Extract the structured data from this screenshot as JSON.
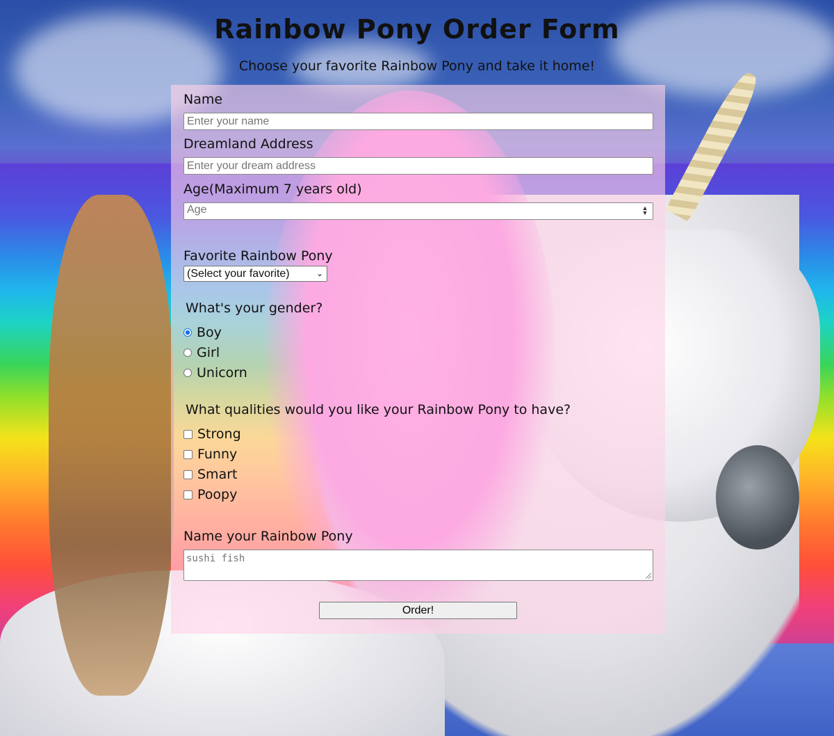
{
  "header": {
    "title": "Rainbow Pony Order Form",
    "subtitle": "Choose your favorite Rainbow Pony and take it home!"
  },
  "form": {
    "name": {
      "label": "Name",
      "placeholder": "Enter your name",
      "value": ""
    },
    "address": {
      "label": "Dreamland Address",
      "placeholder": "Enter your dream address",
      "value": ""
    },
    "age": {
      "label": "Age(Maximum 7 years old)",
      "placeholder": "Age",
      "value": ""
    },
    "favorite": {
      "label": "Favorite Rainbow Pony",
      "selected": "(Select your favorite)"
    },
    "gender": {
      "question": "What's your gender?",
      "options": [
        {
          "label": "Boy",
          "checked": true
        },
        {
          "label": "Girl",
          "checked": false
        },
        {
          "label": "Unicorn",
          "checked": false
        }
      ]
    },
    "qualities": {
      "question": "What qualities would you like your Rainbow Pony to have?",
      "options": [
        {
          "label": "Strong",
          "checked": false
        },
        {
          "label": "Funny",
          "checked": false
        },
        {
          "label": "Smart",
          "checked": false
        },
        {
          "label": "Poopy",
          "checked": false
        }
      ]
    },
    "pony_name": {
      "label": "Name your Rainbow Pony",
      "placeholder": "sushi fish",
      "value": ""
    },
    "submit_label": "Order!"
  },
  "colors": {
    "panel_bg": "#ffd2e6",
    "radio_accent": "#1a73e8"
  }
}
